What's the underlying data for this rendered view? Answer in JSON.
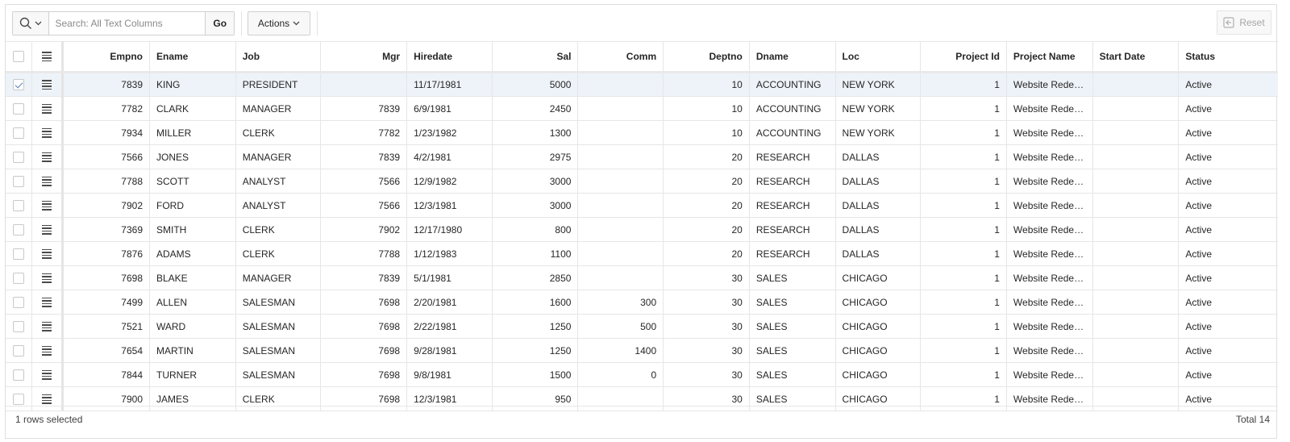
{
  "toolbar": {
    "search_placeholder": "Search: All Text Columns",
    "go_label": "Go",
    "actions_label": "Actions",
    "reset_label": "Reset"
  },
  "grid": {
    "columns": [
      {
        "key": "empno",
        "label": "Empno",
        "align": "num"
      },
      {
        "key": "ename",
        "label": "Ename",
        "align": "text"
      },
      {
        "key": "job",
        "label": "Job",
        "align": "text"
      },
      {
        "key": "mgr",
        "label": "Mgr",
        "align": "num"
      },
      {
        "key": "hiredate",
        "label": "Hiredate",
        "align": "text"
      },
      {
        "key": "sal",
        "label": "Sal",
        "align": "num"
      },
      {
        "key": "comm",
        "label": "Comm",
        "align": "num"
      },
      {
        "key": "deptno",
        "label": "Deptno",
        "align": "num"
      },
      {
        "key": "dname",
        "label": "Dname",
        "align": "text"
      },
      {
        "key": "loc",
        "label": "Loc",
        "align": "text"
      },
      {
        "key": "project_id",
        "label": "Project Id",
        "align": "num"
      },
      {
        "key": "project_name",
        "label": "Project Name",
        "align": "text"
      },
      {
        "key": "start_date",
        "label": "Start Date",
        "align": "text"
      },
      {
        "key": "status",
        "label": "Status",
        "align": "text"
      }
    ],
    "rows": [
      {
        "selected": true,
        "cells": [
          "7839",
          "KING",
          "PRESIDENT",
          "",
          "11/17/1981",
          "5000",
          "",
          "10",
          "ACCOUNTING",
          "NEW YORK",
          "1",
          "Website Redesign",
          "",
          "Active"
        ]
      },
      {
        "selected": false,
        "cells": [
          "7782",
          "CLARK",
          "MANAGER",
          "7839",
          "6/9/1981",
          "2450",
          "",
          "10",
          "ACCOUNTING",
          "NEW YORK",
          "1",
          "Website Redesign",
          "",
          "Active"
        ]
      },
      {
        "selected": false,
        "cells": [
          "7934",
          "MILLER",
          "CLERK",
          "7782",
          "1/23/1982",
          "1300",
          "",
          "10",
          "ACCOUNTING",
          "NEW YORK",
          "1",
          "Website Redesign",
          "",
          "Active"
        ]
      },
      {
        "selected": false,
        "cells": [
          "7566",
          "JONES",
          "MANAGER",
          "7839",
          "4/2/1981",
          "2975",
          "",
          "20",
          "RESEARCH",
          "DALLAS",
          "1",
          "Website Redesign",
          "",
          "Active"
        ]
      },
      {
        "selected": false,
        "cells": [
          "7788",
          "SCOTT",
          "ANALYST",
          "7566",
          "12/9/1982",
          "3000",
          "",
          "20",
          "RESEARCH",
          "DALLAS",
          "1",
          "Website Redesign",
          "",
          "Active"
        ]
      },
      {
        "selected": false,
        "cells": [
          "7902",
          "FORD",
          "ANALYST",
          "7566",
          "12/3/1981",
          "3000",
          "",
          "20",
          "RESEARCH",
          "DALLAS",
          "1",
          "Website Redesign",
          "",
          "Active"
        ]
      },
      {
        "selected": false,
        "cells": [
          "7369",
          "SMITH",
          "CLERK",
          "7902",
          "12/17/1980",
          "800",
          "",
          "20",
          "RESEARCH",
          "DALLAS",
          "1",
          "Website Redesign",
          "",
          "Active"
        ]
      },
      {
        "selected": false,
        "cells": [
          "7876",
          "ADAMS",
          "CLERK",
          "7788",
          "1/12/1983",
          "1100",
          "",
          "20",
          "RESEARCH",
          "DALLAS",
          "1",
          "Website Redesign",
          "",
          "Active"
        ]
      },
      {
        "selected": false,
        "cells": [
          "7698",
          "BLAKE",
          "MANAGER",
          "7839",
          "5/1/1981",
          "2850",
          "",
          "30",
          "SALES",
          "CHICAGO",
          "1",
          "Website Redesign",
          "",
          "Active"
        ]
      },
      {
        "selected": false,
        "cells": [
          "7499",
          "ALLEN",
          "SALESMAN",
          "7698",
          "2/20/1981",
          "1600",
          "300",
          "30",
          "SALES",
          "CHICAGO",
          "1",
          "Website Redesign",
          "",
          "Active"
        ]
      },
      {
        "selected": false,
        "cells": [
          "7521",
          "WARD",
          "SALESMAN",
          "7698",
          "2/22/1981",
          "1250",
          "500",
          "30",
          "SALES",
          "CHICAGO",
          "1",
          "Website Redesign",
          "",
          "Active"
        ]
      },
      {
        "selected": false,
        "cells": [
          "7654",
          "MARTIN",
          "SALESMAN",
          "7698",
          "9/28/1981",
          "1250",
          "1400",
          "30",
          "SALES",
          "CHICAGO",
          "1",
          "Website Redesign",
          "",
          "Active"
        ]
      },
      {
        "selected": false,
        "cells": [
          "7844",
          "TURNER",
          "SALESMAN",
          "7698",
          "9/8/1981",
          "1500",
          "0",
          "30",
          "SALES",
          "CHICAGO",
          "1",
          "Website Redesign",
          "",
          "Active"
        ]
      },
      {
        "selected": false,
        "cells": [
          "7900",
          "JAMES",
          "CLERK",
          "7698",
          "12/3/1981",
          "950",
          "",
          "30",
          "SALES",
          "CHICAGO",
          "1",
          "Website Redesign",
          "",
          "Active"
        ]
      }
    ]
  },
  "footer": {
    "selection_text": "1 rows selected",
    "total_text": "Total 14"
  },
  "colors": {
    "selected_row": "#eef3f9",
    "border": "#e6e6e6",
    "check_mark": "#5a7fb5"
  }
}
